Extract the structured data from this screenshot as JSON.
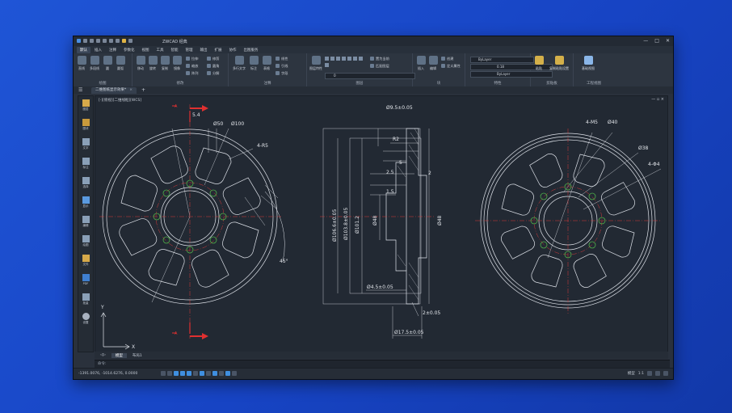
{
  "window": {
    "title": "ZWCAD 经典",
    "controls": [
      "—",
      "□",
      "✕"
    ]
  },
  "menu": [
    "默认",
    "插入",
    "注释",
    "参数化",
    "视图",
    "工具",
    "智能",
    "管理",
    "输出",
    "扩展",
    "协作",
    "出图服务"
  ],
  "ribbon": {
    "groups": [
      {
        "label": "绘图",
        "big": [
          "直线",
          "多段线",
          "圆",
          "圆弧"
        ]
      },
      {
        "label": "修改",
        "big": [
          "移动",
          "旋转",
          "复制",
          "镜像"
        ],
        "small": [
          "拉伸",
          "缩放",
          "阵列",
          "修剪",
          "圆角",
          "分解"
        ]
      },
      {
        "label": "注释",
        "big": [
          "多行文字",
          "标注",
          "表格"
        ],
        "small": [
          "线性",
          "引线",
          "字段"
        ]
      },
      {
        "label": "图层",
        "big": [
          "图层特性"
        ],
        "small": [
          "置为当前",
          "匹配图层"
        ],
        "current_layer": "0"
      },
      {
        "label": "块",
        "big": [
          "插入",
          "编辑"
        ],
        "small": [
          "创建",
          "定义属性"
        ]
      },
      {
        "label": "特性",
        "small": [
          "ByLayer",
          "ByLayer",
          "ByLayer"
        ],
        "lineweight": "0.18"
      },
      {
        "label": "剪贴板",
        "big": [
          "粘贴",
          "复制粘贴设置"
        ]
      },
      {
        "label": "工程视图",
        "big": [
          "基础视图"
        ]
      }
    ]
  },
  "doc_tab": "二维图纸显示效果*",
  "viewport_label": "[-][俯视][二维线框][WCS]",
  "left_toolbar": [
    "图层",
    "图块",
    "文字",
    "标注",
    "选择",
    "显示",
    "编辑",
    "绘图",
    "文件",
    "PDF",
    "批量",
    "设置"
  ],
  "drawing": {
    "front_view": {
      "dims": [
        "5.4",
        "Ø50",
        "Ø100",
        "4-R5",
        "45°"
      ]
    },
    "section_view": {
      "dims": [
        "Ø9.5±0.05",
        "R2",
        "5",
        "2.5",
        "1.5",
        "2",
        "Ø106.6±0.05",
        "Ø101.2",
        "Ø103.8±0.05",
        "Ø48",
        "Ø48",
        "Ø4.5±0.05",
        "Ø17.5±0.05",
        "2±0.05"
      ]
    },
    "back_view": {
      "dims": [
        "4-M5",
        "Ø40",
        "Ø38",
        "4-Φ4"
      ]
    },
    "section_marks": [
      "A",
      "A"
    ],
    "ucs": {
      "x": "X",
      "y": "Y"
    }
  },
  "layout_tabs": [
    "模型",
    "布局1"
  ],
  "active_layout": "模型",
  "command_line": "命令:",
  "status": {
    "coordinates": "-1391.0076, -1014.6276, 0.0000",
    "scale": "1:1",
    "annotation": "模型"
  },
  "colors": {
    "background": "#1a4ecf",
    "canvas": "#222933",
    "drawing_line": "#dfe3ea",
    "center_line": "#d93a3a",
    "hole": "#4fae4a",
    "section_arrow": "#e03030"
  }
}
